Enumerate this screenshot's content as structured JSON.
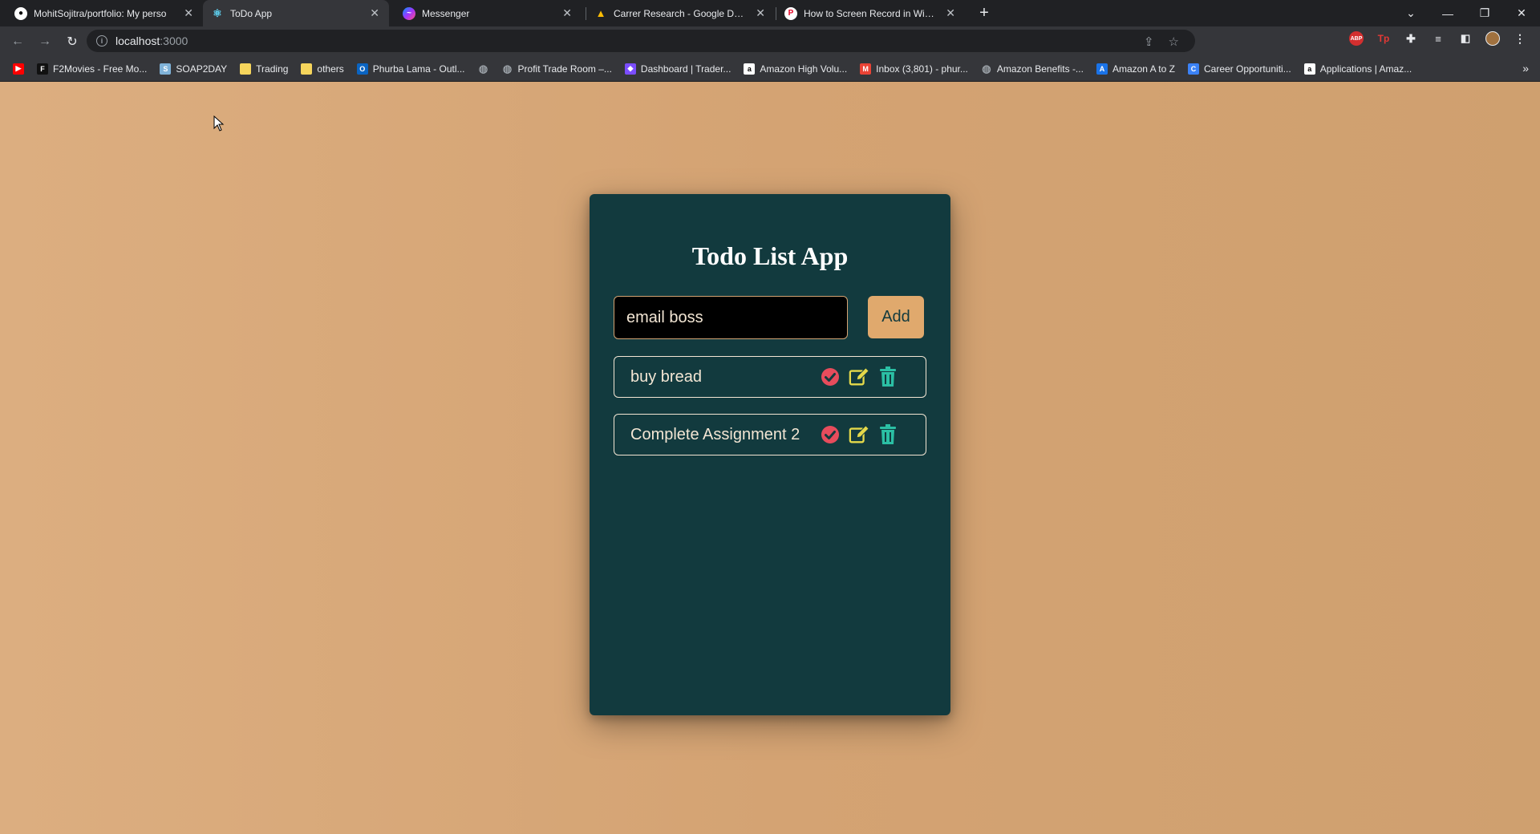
{
  "browser": {
    "tabs": [
      {
        "title": "MohitSojitra/portfolio: My perso",
        "icon": "github-icon",
        "active": false
      },
      {
        "title": "ToDo App",
        "icon": "react-icon",
        "active": true
      },
      {
        "title": "Messenger",
        "icon": "messenger-icon",
        "active": false
      },
      {
        "title": "Carrer Research - Google Drive",
        "icon": "google-drive-icon",
        "active": false
      },
      {
        "title": "How to Screen Record in Window",
        "icon": "pinterest-icon",
        "active": false
      }
    ],
    "url_host": "localhost",
    "url_port": ":3000",
    "bookmarks": [
      {
        "label": "",
        "icon": "youtube-icon",
        "color": "#ff0000"
      },
      {
        "label": "F2Movies - Free Mo...",
        "icon": "f2movies-icon",
        "color": "#111111"
      },
      {
        "label": "SOAP2DAY",
        "icon": "soap2day-icon",
        "color": "#7fb2d8"
      },
      {
        "label": "Trading",
        "icon": "folder-icon",
        "color": "#f6d55c"
      },
      {
        "label": "others",
        "icon": "folder-icon",
        "color": "#f6d55c"
      },
      {
        "label": "Phurba Lama - Outl...",
        "icon": "outlook-icon",
        "color": "#0a64c2"
      },
      {
        "label": "",
        "icon": "globe-icon",
        "color": "#9aa0a6"
      },
      {
        "label": "Profit Trade Room –...",
        "icon": "globe-icon",
        "color": "#9aa0a6"
      },
      {
        "label": "Dashboard | Trader...",
        "icon": "trader-icon",
        "color": "#7b4dff"
      },
      {
        "label": "Amazon High Volu...",
        "icon": "amazon-icon",
        "color": "#ffffff"
      },
      {
        "label": "Inbox (3,801) - phur...",
        "icon": "gmail-icon",
        "color": "#ea4335"
      },
      {
        "label": "Amazon Benefits -...",
        "icon": "globe-icon",
        "color": "#9aa0a6"
      },
      {
        "label": "Amazon A to Z",
        "icon": "atoz-icon",
        "color": "#1a73e8"
      },
      {
        "label": "Career Opportuniti...",
        "icon": "career-icon",
        "color": "#3b82f6"
      },
      {
        "label": "Applications | Amaz...",
        "icon": "amazon-icon",
        "color": "#ffffff"
      }
    ]
  },
  "app": {
    "title": "Todo List App",
    "input_value": "email boss",
    "add_label": "Add",
    "todos": [
      {
        "text": "buy bread"
      },
      {
        "text": "Complete Assignment 2"
      }
    ],
    "colors": {
      "card_bg": "#123a3e",
      "page_bg": "#d4a373",
      "accent": "#e0a96d",
      "complete_icon": "#e74c5c",
      "edit_icon": "#e5d94a",
      "delete_icon": "#2bbfa4"
    }
  }
}
